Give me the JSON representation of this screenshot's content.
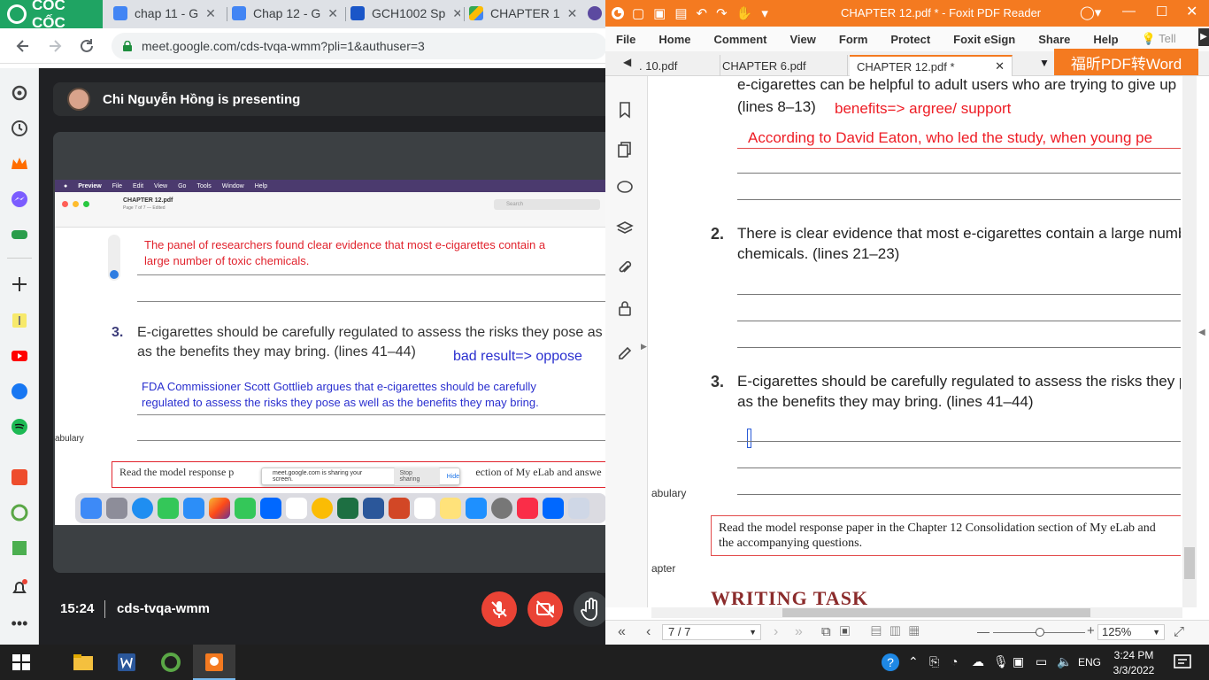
{
  "browser": {
    "brand": "CỐC CỐC",
    "tabs": [
      {
        "label": "chap 11 - G",
        "color": "#4285f4"
      },
      {
        "label": "Chap 12 - G",
        "color": "#4285f4"
      },
      {
        "label": "GCH1002 Sp",
        "color": "#1a56c8"
      },
      {
        "label": "CHAPTER 1",
        "color": "#fbbc04"
      }
    ],
    "url": "meet.google.com/cds-tvqa-wmm?pli=1&authuser=3"
  },
  "meet": {
    "presenter": "Chi Nguyễn Hồng is presenting",
    "time": "15:24",
    "code": "cds-tvqa-wmm"
  },
  "shared_screen": {
    "menu": [
      "Preview",
      "File",
      "Edit",
      "View",
      "Go",
      "Tools",
      "Window",
      "Help"
    ],
    "doc_title": "CHAPTER 12.pdf",
    "doc_subtitle": "Page 7 of 7 — Edited",
    "search_placeholder": "Search",
    "red_note_1": "The panel of researchers found clear evidence that most e-cigarettes contain a",
    "red_note_2": "large number of toxic chemicals.",
    "q3_num": "3.",
    "q3_line1": "E-cigarettes should be carefully regulated to assess the risks they pose as w",
    "q3_line2": "as the benefits they may bring. (lines 41–44)",
    "q3_annotation": "bad result=> oppose",
    "blue_note_1": "FDA Commissioner Scott Gottlieb argues that e-cigarettes should be carefully",
    "blue_note_2": "regulated to assess the risks they pose as well as the benefits they may bring.",
    "side_label": "abulary",
    "bottom_text": "Read the model response p",
    "bottom_text_tail": "ection of My eLab and answe",
    "sharing_notice": "meet.google.com is sharing your screen.",
    "stop_sharing": "Stop sharing",
    "hide": "Hide"
  },
  "foxit": {
    "title": "CHAPTER 12.pdf * - Foxit PDF Reader",
    "menu": [
      "File",
      "Home",
      "Comment",
      "View",
      "Form",
      "Protect",
      "Foxit eSign",
      "Share",
      "Help"
    ],
    "tell": "Tell",
    "tabs": [
      ". 10.pdf",
      "CHAPTER 6.pdf",
      "CHAPTER 12.pdf *"
    ],
    "convert_button": "福昕PDF转Word",
    "page": {
      "q1_line1": "e-cigarettes can be helpful to adult users who are trying to give up",
      "q1_line2": "(lines 8–13)",
      "q1_annotation": "benefits=> argree/ support",
      "q1_answer": "According to David Eaton, who led the study, when young pe",
      "q2_num": "2.",
      "q2_line1": "There is clear evidence that most e-cigarettes contain a large numbe",
      "q2_line2": "chemicals. (lines 21–23)",
      "q3_num": "3.",
      "q3_line1": "E-cigarettes should be carefully regulated to assess the risks they po",
      "q3_line2": "as the benefits they may bring. (lines 41–44)",
      "side_label_1": "abulary",
      "side_label_2": "apter",
      "box_line1": "Read the model response paper in the Chapter 12 Consolidation section of My eLab and",
      "box_line2": "the accompanying questions.",
      "heading": "WRITING TASK"
    },
    "status": {
      "page": "7 / 7",
      "zoom": "125%"
    }
  },
  "taskbar": {
    "lang": "ENG",
    "time": "3:24 PM",
    "date": "3/3/2022"
  }
}
